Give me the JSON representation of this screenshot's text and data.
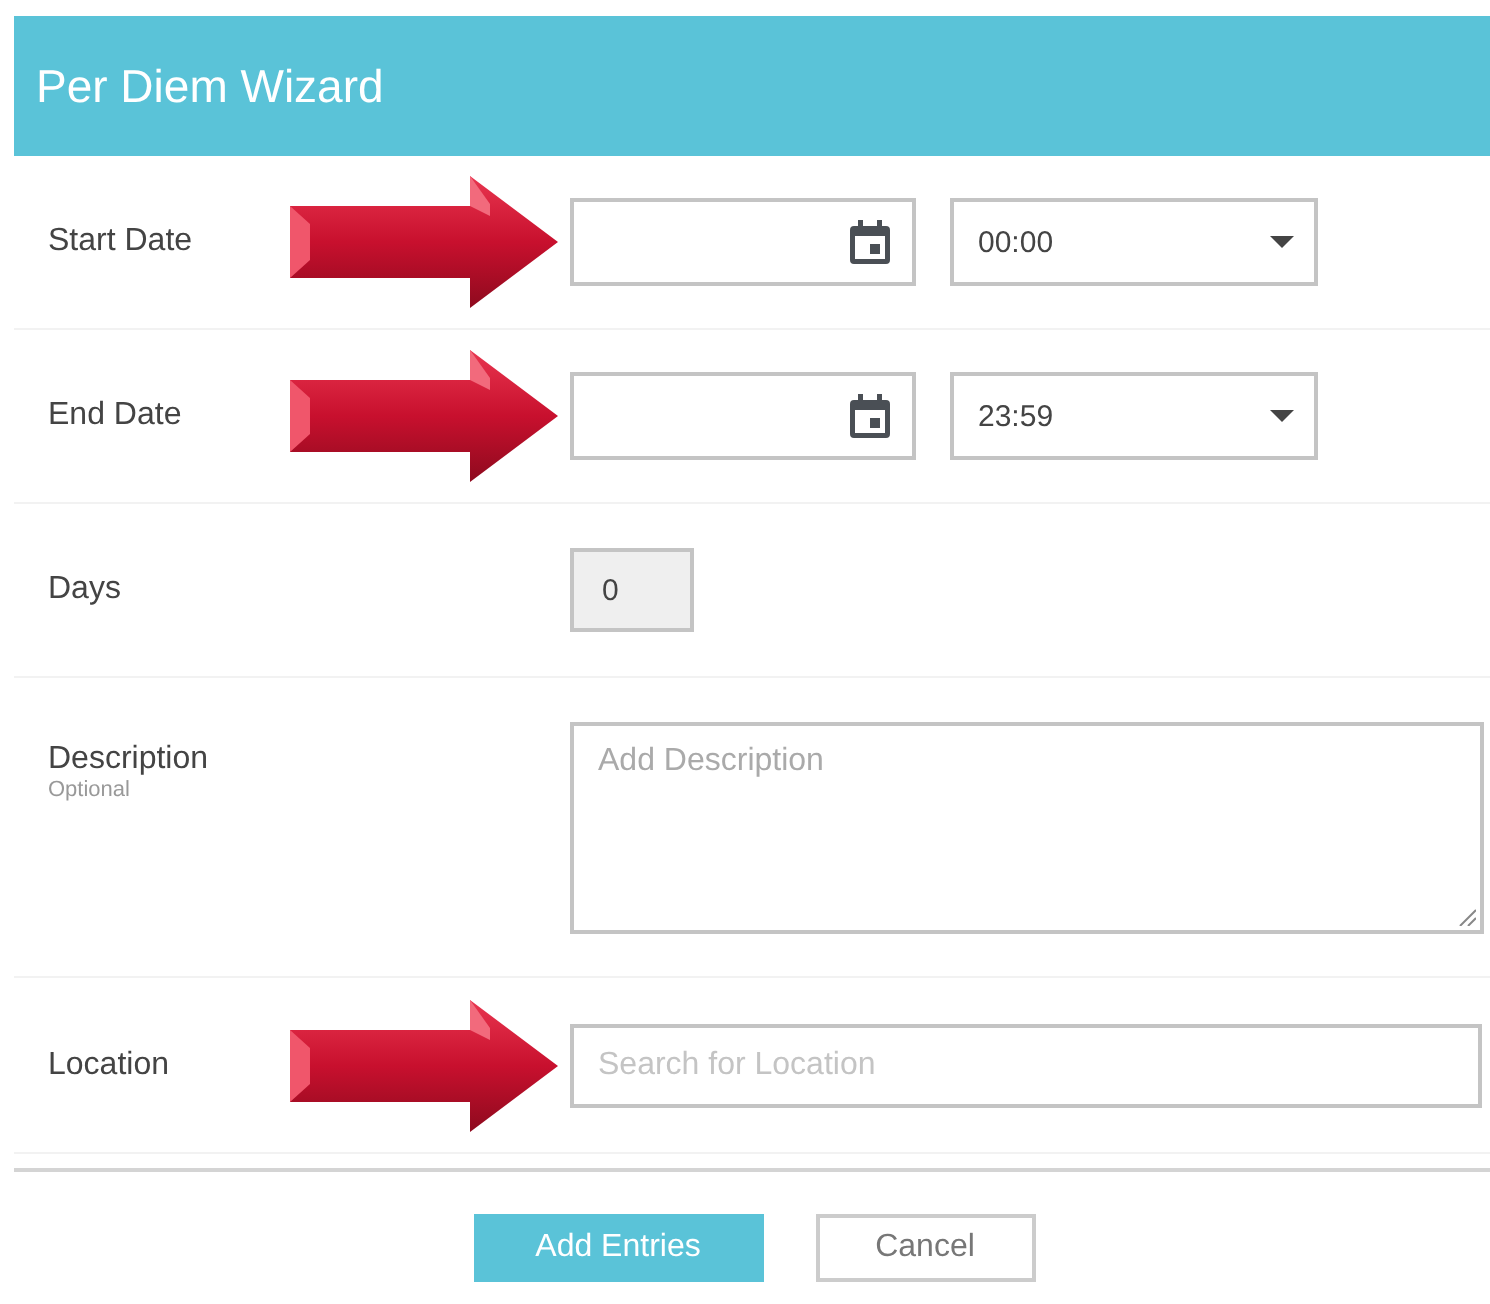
{
  "title": "Per Diem Wizard",
  "rows": [
    {
      "kind": "datetime",
      "label": "Start Date",
      "arrow": true,
      "time": "00:00"
    },
    {
      "kind": "datetime",
      "label": "End Date",
      "arrow": true,
      "time": "23:59"
    },
    {
      "kind": "number",
      "label": "Days",
      "arrow": false,
      "value": "0"
    },
    {
      "kind": "textarea",
      "label": "Description",
      "hint": "Optional",
      "arrow": false,
      "placeholder": "Add Description"
    },
    {
      "kind": "search",
      "label": "Location",
      "arrow": true,
      "placeholder": "Search for Location"
    }
  ],
  "buttons": [
    {
      "label": "Add Entries",
      "primary": true
    },
    {
      "label": "Cancel",
      "primary": false
    }
  ]
}
